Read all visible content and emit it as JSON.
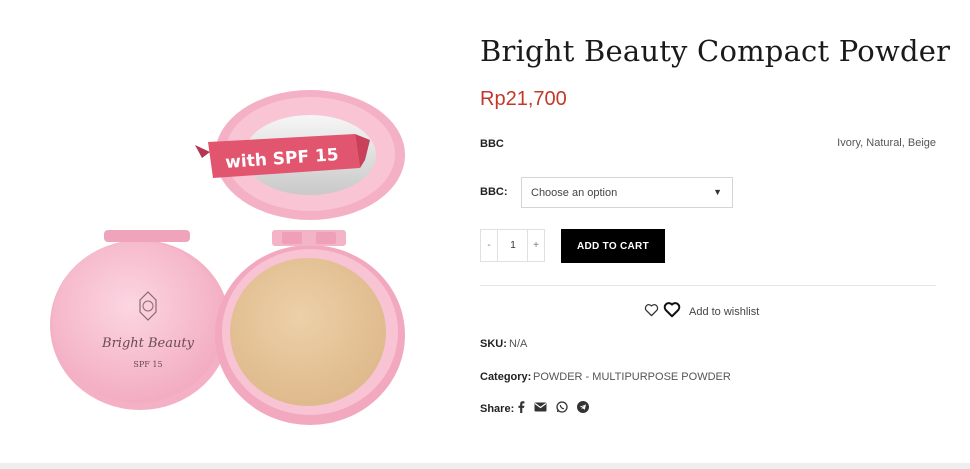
{
  "product": {
    "title": "Bright Beauty Compact Powder",
    "price": "Rp21,700",
    "attribute": {
      "name": "BBC",
      "values": "Ivory, Natural, Beige"
    },
    "variation": {
      "label": "BBC:",
      "placeholder": "Choose an option"
    },
    "quantity": {
      "value": "1",
      "minus": "-",
      "plus": "+"
    },
    "add_to_cart": "ADD TO CART",
    "wishlist": "Add to wishlist",
    "sku": {
      "label": "SKU:",
      "value": "N/A"
    },
    "category": {
      "label": "Category:",
      "value": "POWDER - MULTIPURPOSE POWDER"
    },
    "share": {
      "label": "Share:",
      "icons": [
        "facebook-icon",
        "email-icon",
        "whatsapp-icon",
        "telegram-icon"
      ]
    }
  },
  "image": {
    "banner": "with SPF 15",
    "lid_brand": "Bright Beauty",
    "lid_spf": "SPF 15",
    "colors": {
      "case": "#f5b8cb",
      "powder": "#e8c79c",
      "banner": "#e2556e"
    }
  },
  "colors": {
    "price": "#c0392b",
    "button": "#000000"
  }
}
